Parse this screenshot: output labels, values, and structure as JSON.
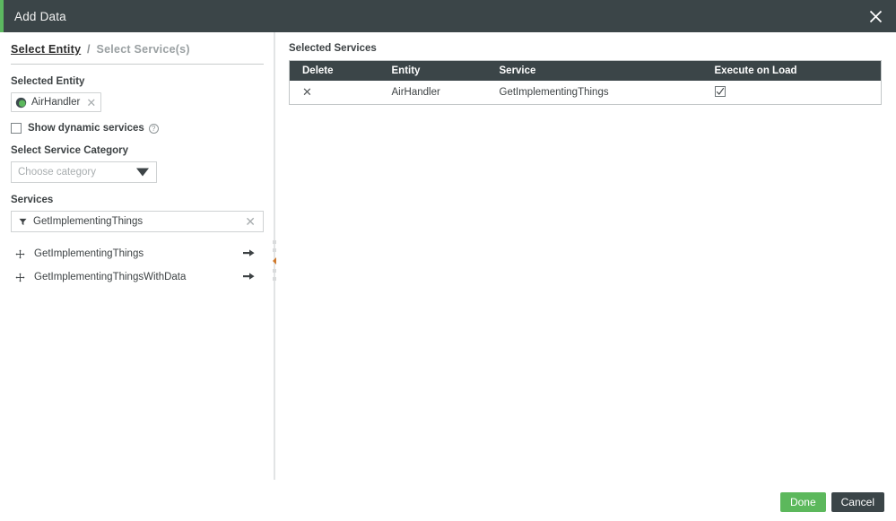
{
  "window": {
    "title": "Add Data",
    "close_icon": "close-icon",
    "accent_color": "#5cb860",
    "header_bg": "#3b4548"
  },
  "breadcrumb": {
    "active_step": "Select Entity",
    "separator": "/",
    "inactive_step": "Select Service(s)"
  },
  "left_panel": {
    "selected_entity_label": "Selected Entity",
    "entity_chip": {
      "icon": "thing-entity-icon",
      "label": "AirHandler",
      "remove_icon": "close-icon"
    },
    "dynamic_services": {
      "checkbox_icon": "checkbox-unchecked-icon",
      "checked": false,
      "label": "Show dynamic services",
      "help_icon": "help-circle-icon",
      "help_glyph": "?"
    },
    "service_category_label": "Select Service Category",
    "category_select": {
      "placeholder": "Choose category",
      "value": "",
      "caret_icon": "chevron-down-icon"
    },
    "services_label": "Services",
    "services_filter": {
      "filter_icon": "funnel-icon",
      "value": "GetImplementingThings",
      "placeholder": "",
      "clear_icon": "close-icon"
    },
    "service_items": [
      {
        "move_icon": "move-handle-icon",
        "name": "GetImplementingThings",
        "action_icon": "arrow-right-icon"
      },
      {
        "move_icon": "move-handle-icon",
        "name": "GetImplementingThingsWithData",
        "action_icon": "arrow-right-icon"
      }
    ]
  },
  "splitter": {
    "collapse_icon": "collapse-left-icon"
  },
  "right_panel": {
    "title": "Selected Services",
    "table": {
      "columns": [
        "Delete",
        "Entity",
        "Service",
        "Execute on Load"
      ],
      "rows": [
        {
          "delete_icon": "delete-x-icon",
          "delete_glyph": "✕",
          "entity": "AirHandler",
          "service": "GetImplementingThings",
          "execute_on_load": true,
          "execute_icon": "checkbox-checked-icon"
        }
      ]
    }
  },
  "footer": {
    "done_label": "Done",
    "cancel_label": "Cancel",
    "done_color": "#5cb85c",
    "cancel_color": "#3b4548"
  }
}
